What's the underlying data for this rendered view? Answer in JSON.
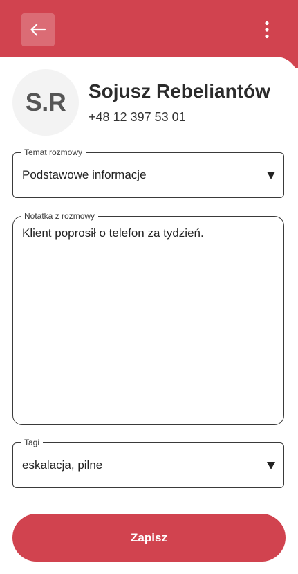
{
  "header": {
    "back_icon": "arrow-left-icon",
    "menu_icon": "more-vertical-icon",
    "color": "#d1434f"
  },
  "contact": {
    "initials": "S.R",
    "name": "Sojusz Rebeliantów",
    "phone": "+48 12 397 53 01"
  },
  "form": {
    "topic": {
      "label": "Temat rozmowy",
      "value": "Podstawowe informacje"
    },
    "note": {
      "label": "Notatka z rozmowy",
      "value": "Klient poprosił o telefon za tydzień."
    },
    "tags": {
      "label": "Tagi",
      "value": "eskalacja, pilne"
    }
  },
  "actions": {
    "save_label": "Zapisz"
  },
  "colors": {
    "accent": "#d1434f",
    "avatar_bg": "#f3f3f3",
    "text": "#2a2a2a"
  }
}
